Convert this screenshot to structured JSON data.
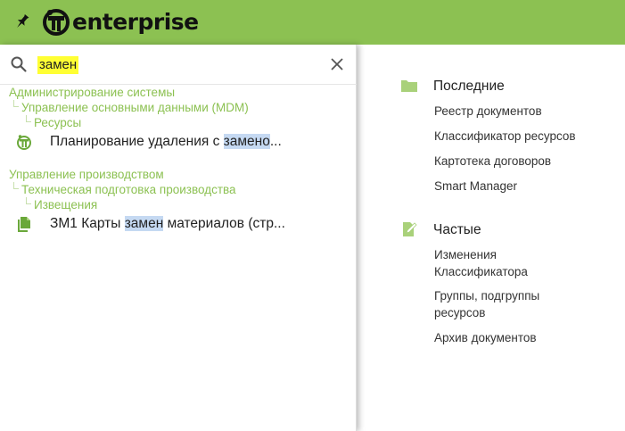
{
  "app": {
    "logo_text": "enterprise",
    "brand_color": "#8cc152"
  },
  "search": {
    "value": "замен",
    "highlight_color": "#ffff33",
    "match_highlight_color": "#c5d9f2"
  },
  "results": [
    {
      "path": [
        "Администрирование системы",
        "Управление основными данными (MDM)",
        "Ресурсы"
      ],
      "icon": "app-logo-icon",
      "text_before": "Планирование удаления с ",
      "text_match": "замен",
      "text_after_hl": "о",
      "text_after": "..."
    },
    {
      "path": [
        "Управление производством",
        "Техническая подготовка производства",
        "Извещения"
      ],
      "icon": "document-copy-icon",
      "text_before": "ЗМ1 Карты ",
      "text_match": "замен",
      "text_after_hl": "",
      "text_after": " материалов (стр..."
    }
  ],
  "recent": {
    "title": "Последние",
    "icon": "folder-icon",
    "items": [
      "Реестр документов",
      "Классификатор ресурсов",
      "Картотека договоров",
      "Smart Manager"
    ]
  },
  "frequent": {
    "title": "Частые",
    "icon": "edit-document-icon",
    "items": [
      "Изменения Классификатора",
      "Группы, подгруппы ресурсов",
      "Архив документов"
    ]
  }
}
